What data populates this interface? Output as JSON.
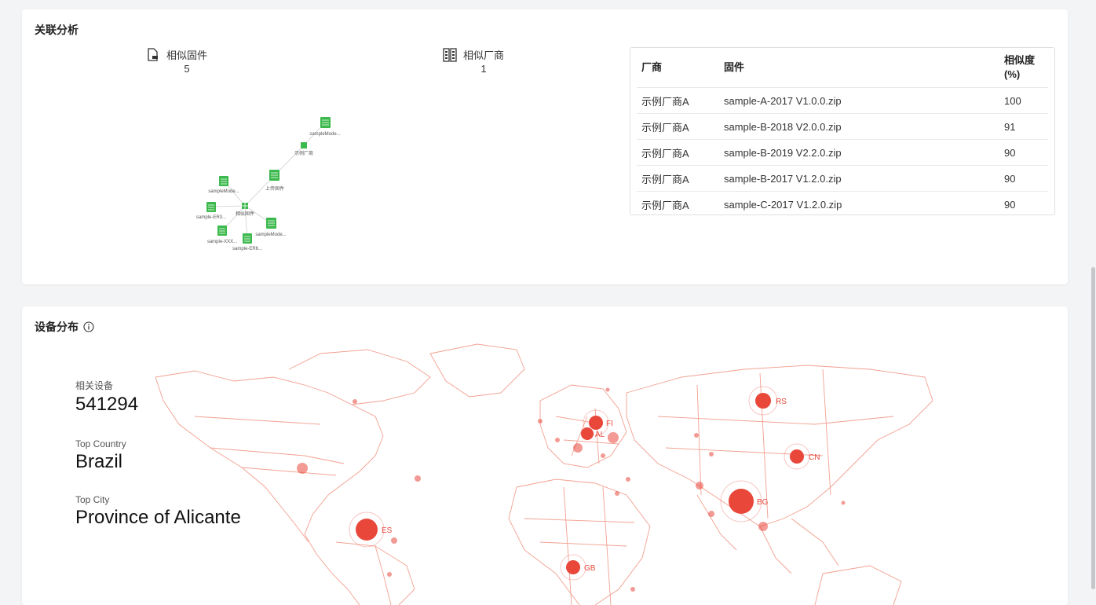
{
  "association": {
    "title": "关联分析",
    "similar_firmware": {
      "label": "相似固件",
      "count": "5"
    },
    "similar_vendor": {
      "label": "相似厂商",
      "count": "1"
    },
    "graph_nodes": {
      "top": "sampleMode...",
      "vendor": "示例厂商",
      "uploaded": "上传固件",
      "left_top": "sampleMode...",
      "left_mid": "sample-ER3...",
      "center": "相似固件",
      "right_bottom": "sampleMode...",
      "left_bottom": "sample-XXX...",
      "bottom": "sample-ER6..."
    },
    "table": {
      "headers": {
        "vendor": "厂商",
        "firmware": "固件",
        "similarity": "相似度",
        "similarity_unit": "(%)"
      },
      "rows": [
        {
          "vendor": "示例厂商A",
          "firmware": "sample-A-2017 V1.0.0.zip",
          "similarity": "100"
        },
        {
          "vendor": "示例厂商A",
          "firmware": "sample-B-2018 V2.0.0.zip",
          "similarity": "91"
        },
        {
          "vendor": "示例厂商A",
          "firmware": "sample-B-2019 V2.2.0.zip",
          "similarity": "90"
        },
        {
          "vendor": "示例厂商A",
          "firmware": "sample-B-2017 V1.2.0.zip",
          "similarity": "90"
        },
        {
          "vendor": "示例厂商A",
          "firmware": "sample-C-2017 V1.2.0.zip",
          "similarity": "90"
        }
      ]
    }
  },
  "distribution": {
    "title": "设备分布",
    "related_devices": {
      "label": "相关设备",
      "value": "541294"
    },
    "top_country": {
      "label": "Top Country",
      "value": "Brazil"
    },
    "top_city": {
      "label": "Top City",
      "value": "Province of Alicante"
    },
    "map_labels": {
      "rs": "RS",
      "fi": "FI",
      "al": "AL",
      "cn": "CN",
      "bg": "BG",
      "es": "ES",
      "gb": "GB"
    }
  },
  "colors": {
    "map_line": "#f2a090",
    "bubble": "#e8473a",
    "node": "#3cb94d"
  }
}
